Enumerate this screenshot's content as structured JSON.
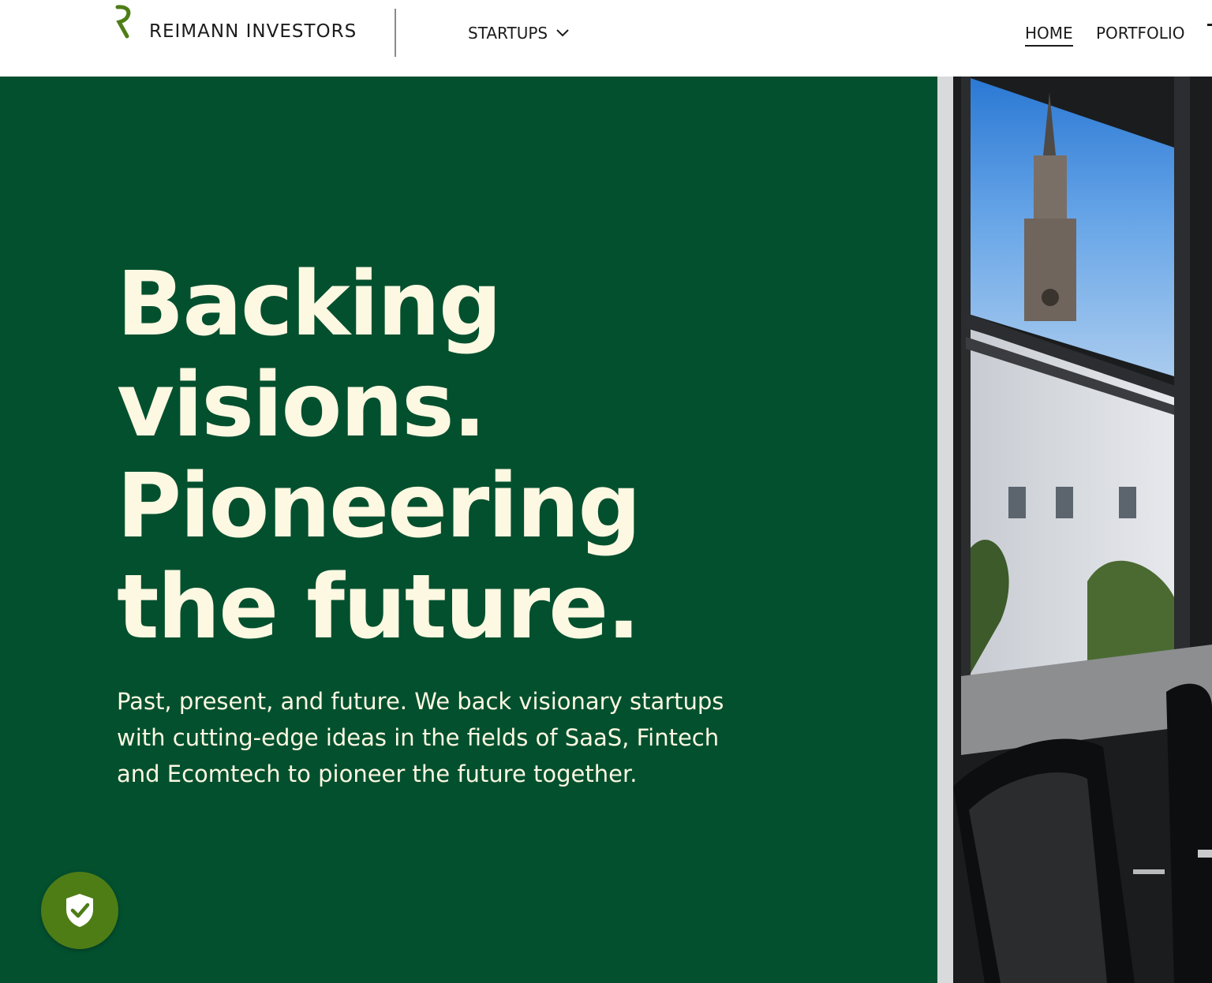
{
  "header": {
    "brand_name": "REIMANN INVESTORS",
    "logo_icon": "r-monogram-logo",
    "nav": {
      "startups_label": "STARTUPS",
      "startups_icon": "chevron-down-icon",
      "home_label": "HOME",
      "portfolio_label": "PORTFOLIO"
    }
  },
  "hero": {
    "headline_lines": [
      "Backing",
      "visions.",
      "Pioneering",
      "the future."
    ],
    "description": "Past, present, and future. We back visionary startups with cutting-edge ideas in the fields of SaaS, Fintech and Ecomtech to pioneer the future together.",
    "image_icon": "office-window-city-tower-photo"
  },
  "privacy_button": {
    "icon": "shield-check-icon"
  },
  "colors": {
    "hero_background": "#03502f",
    "hero_text": "#fdf8e1",
    "logo_green": "#4e7d16",
    "privacy_button": "#4e7d16"
  }
}
